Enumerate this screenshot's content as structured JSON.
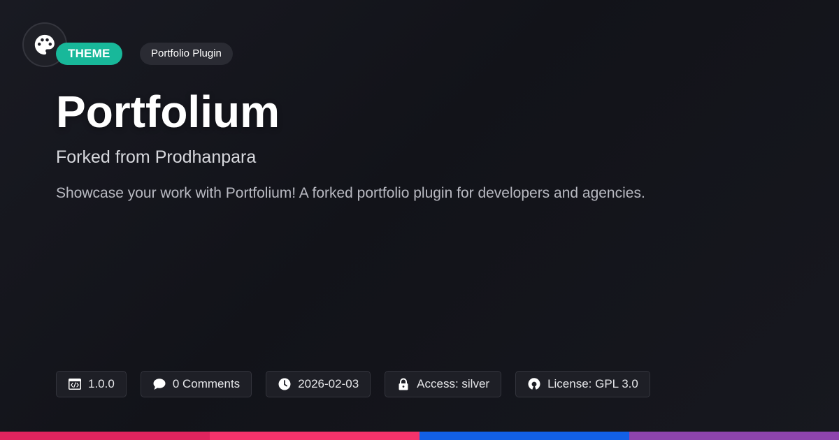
{
  "logo": {
    "icon": "palette-icon"
  },
  "badges": {
    "category": "THEME",
    "type": "Portfolio Plugin"
  },
  "title": "Portfolium",
  "subtitle": "Forked from Prodhanpara",
  "description": "Showcase your work with Portfolium! A forked portfolio plugin for developers and agencies.",
  "meta": {
    "version": "1.0.0",
    "comments": "0 Comments",
    "date": "2026-02-03",
    "access": "Access: silver",
    "license": "License: GPL 3.0"
  },
  "colors": {
    "accent": "#18b89a",
    "bar": [
      "#e0245e",
      "#f5336b",
      "#1260e6",
      "#8e44ad"
    ]
  }
}
